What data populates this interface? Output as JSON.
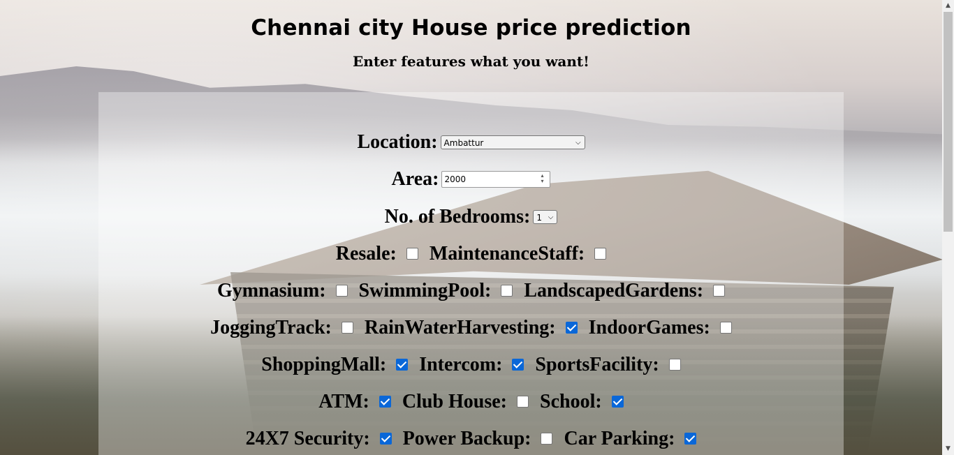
{
  "page": {
    "title": "Chennai city House price prediction",
    "subtitle": "Enter features what you want!"
  },
  "form": {
    "location": {
      "label": "Location:",
      "value": "Ambattur"
    },
    "area": {
      "label": "Area:",
      "value": "2000"
    },
    "bedrooms": {
      "label": "No. of Bedrooms:",
      "value": "1"
    },
    "checkboxes": [
      {
        "label": "Resale:",
        "checked": false
      },
      {
        "label": "MaintenanceStaff:",
        "checked": false
      },
      {
        "label": "Gymnasium:",
        "checked": false
      },
      {
        "label": "SwimmingPool:",
        "checked": false
      },
      {
        "label": "LandscapedGardens:",
        "checked": false
      },
      {
        "label": "JoggingTrack:",
        "checked": false
      },
      {
        "label": "RainWaterHarvesting:",
        "checked": true
      },
      {
        "label": "IndoorGames:",
        "checked": false
      },
      {
        "label": "ShoppingMall:",
        "checked": true
      },
      {
        "label": "Intercom:",
        "checked": true
      },
      {
        "label": "SportsFacility:",
        "checked": false
      },
      {
        "label": "ATM:",
        "checked": true
      },
      {
        "label": "Club House:",
        "checked": false
      },
      {
        "label": "School:",
        "checked": true
      },
      {
        "label": "24X7 Security:",
        "checked": true
      },
      {
        "label": "Power Backup:",
        "checked": false
      },
      {
        "label": "Car Parking:",
        "checked": true
      }
    ]
  },
  "icons": {
    "select_chevron": "chevron-down-icon",
    "spinner": "spin-arrows-icon",
    "scroll_up": "scroll-up-arrow-icon",
    "scroll_down": "scroll-down-arrow-icon"
  },
  "colors": {
    "checkbox_checked": "#0a67d8",
    "panel_overlay": "rgba(255,255,255,0.35)"
  }
}
